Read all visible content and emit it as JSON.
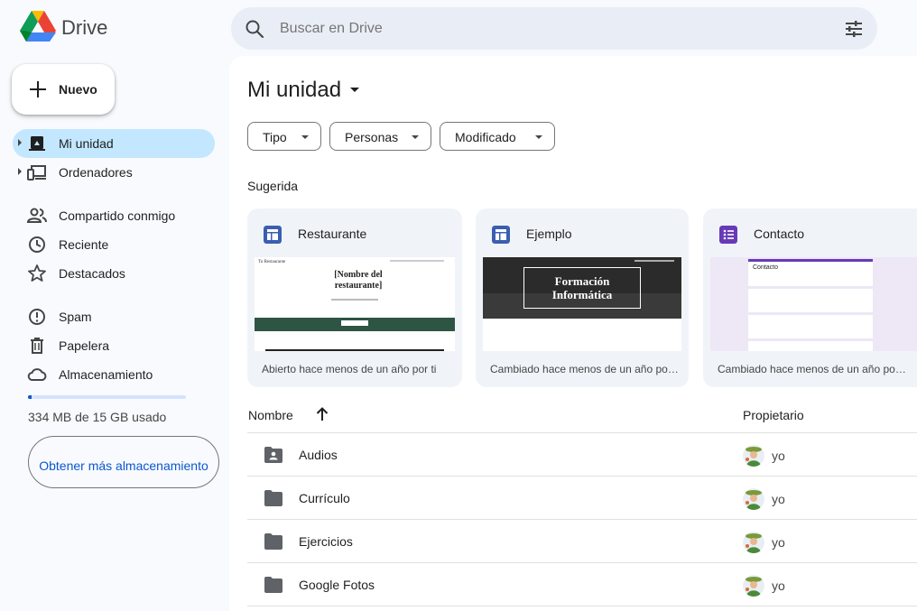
{
  "app": {
    "name": "Drive"
  },
  "search": {
    "placeholder": "Buscar en Drive"
  },
  "sidebar": {
    "new_button": "Nuevo",
    "items": [
      {
        "label": "Mi unidad"
      },
      {
        "label": "Ordenadores"
      },
      {
        "label": "Compartido conmigo"
      },
      {
        "label": "Reciente"
      },
      {
        "label": "Destacados"
      },
      {
        "label": "Spam"
      },
      {
        "label": "Papelera"
      },
      {
        "label": "Almacenamiento"
      }
    ],
    "storage": {
      "used_text": "334 MB de 15 GB usado",
      "fraction": 0.022,
      "button_label": "Obtener más almacenamiento"
    }
  },
  "main": {
    "title": "Mi unidad",
    "filters": [
      "Tipo",
      "Personas",
      "Modificado"
    ],
    "suggested_label": "Sugerida",
    "cards": [
      {
        "name": "Restaurante",
        "meta": "Abierto hace menos de un año por ti",
        "thumb_title": "[Nombre del restaurante]",
        "thumb_brand": "Tu Restaurante"
      },
      {
        "name": "Ejemplo",
        "meta": "Cambiado hace menos de un año por ti",
        "thumb_title_1": "Formación",
        "thumb_title_2": "Informática"
      },
      {
        "name": "Contacto",
        "meta": "Cambiado hace menos de un año por ti",
        "thumb_title": "Contacto"
      }
    ],
    "list": {
      "col_name": "Nombre",
      "col_owner": "Propietario",
      "rows": [
        {
          "name": "Audios",
          "owner": "yo",
          "shared": true
        },
        {
          "name": "Currículo",
          "owner": "yo",
          "shared": false
        },
        {
          "name": "Ejercicios",
          "owner": "yo",
          "shared": false
        },
        {
          "name": "Google Fotos",
          "owner": "yo",
          "shared": false
        }
      ]
    }
  },
  "colors": {
    "accent": "#0b57d0",
    "active_nav": "#c2e7ff",
    "sites_icon": "#3b5eaf",
    "forms_icon": "#673ab7",
    "folder": "#5f6368"
  }
}
